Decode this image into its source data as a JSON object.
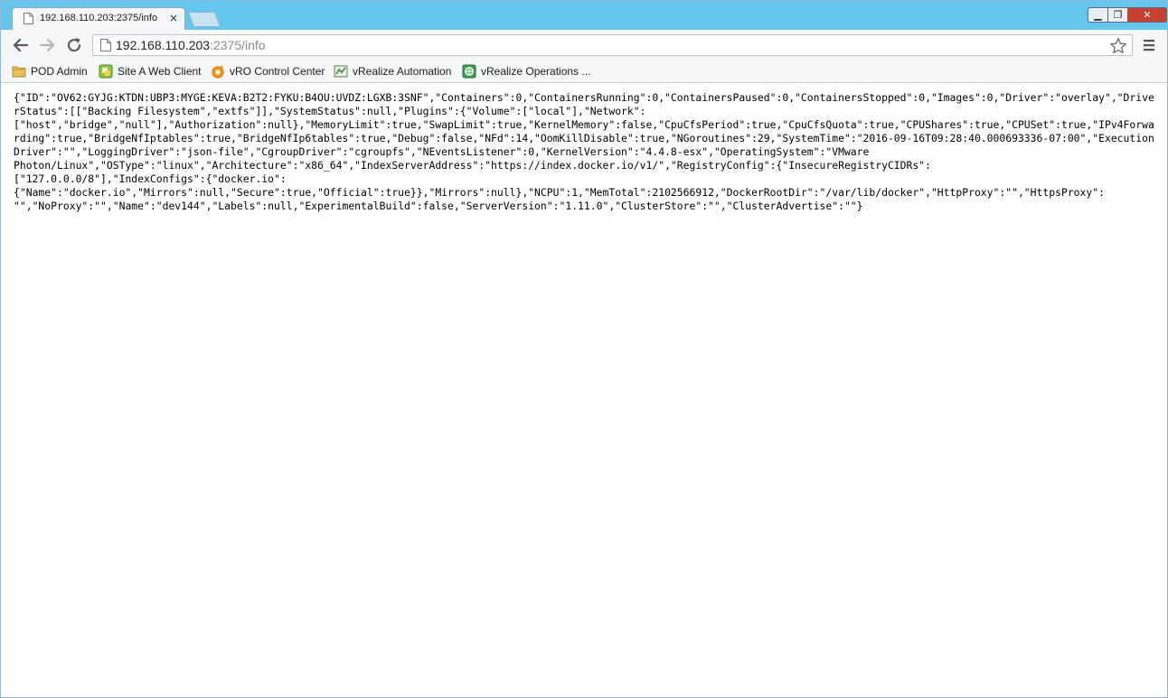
{
  "tab": {
    "title": "192.168.110.203:2375/info",
    "close_glyph": "×"
  },
  "window_controls": {
    "minimize": "▁",
    "maximize": "❐",
    "close": "✕"
  },
  "address_bar": {
    "host": "192.168.110.203",
    "rest": ":2375/info"
  },
  "bookmarks": [
    {
      "label": "POD Admin",
      "icon": "folder-icon"
    },
    {
      "label": "Site A Web Client",
      "icon": "web-client-icon"
    },
    {
      "label": "vRO Control Center",
      "icon": "vro-icon"
    },
    {
      "label": "vRealize Automation",
      "icon": "vra-icon"
    },
    {
      "label": "vRealize Operations ...",
      "icon": "vrops-icon"
    }
  ],
  "page": {
    "json_text": "{\"ID\":\"OV62:GYJG:KTDN:UBP3:MYGE:KEVA:B2T2:FYKU:B4OU:UVDZ:LGXB:3SNF\",\"Containers\":0,\"ContainersRunning\":0,\"ContainersPaused\":0,\"ContainersStopped\":0,\"Images\":0,\"Driver\":\"overlay\",\"DriverStatus\":[[\"Backing Filesystem\",\"extfs\"]],\"SystemStatus\":null,\"Plugins\":{\"Volume\":[\"local\"],\"Network\":\n[\"host\",\"bridge\",\"null\"],\"Authorization\":null},\"MemoryLimit\":true,\"SwapLimit\":true,\"KernelMemory\":false,\"CpuCfsPeriod\":true,\"CpuCfsQuota\":true,\"CPUShares\":true,\"CPUSet\":true,\"IPv4Forwarding\":true,\"BridgeNfIptables\":true,\"BridgeNfIp6tables\":true,\"Debug\":false,\"NFd\":14,\"OomKillDisable\":true,\"NGoroutines\":29,\"SystemTime\":\"2016-09-16T09:28:40.000693336-07:00\",\"ExecutionDriver\":\"\",\"LoggingDriver\":\"json-file\",\"CgroupDriver\":\"cgroupfs\",\"NEventsListener\":0,\"KernelVersion\":\"4.4.8-esx\",\"OperatingSystem\":\"VMware\nPhoton/Linux\",\"OSType\":\"linux\",\"Architecture\":\"x86_64\",\"IndexServerAddress\":\"https://index.docker.io/v1/\",\"RegistryConfig\":{\"InsecureRegistryCIDRs\":\n[\"127.0.0.0/8\"],\"IndexConfigs\":{\"docker.io\":\n{\"Name\":\"docker.io\",\"Mirrors\":null,\"Secure\":true,\"Official\":true}},\"Mirrors\":null},\"NCPU\":1,\"MemTotal\":2102566912,\"DockerRootDir\":\"/var/lib/docker\",\"HttpProxy\":\"\",\"HttpsProxy\":\n\"\",\"NoProxy\":\"\",\"Name\":\"dev144\",\"Labels\":null,\"ExperimentalBuild\":false,\"ServerVersion\":\"1.11.0\",\"ClusterStore\":\"\",\"ClusterAdvertise\":\"\"}"
  }
}
